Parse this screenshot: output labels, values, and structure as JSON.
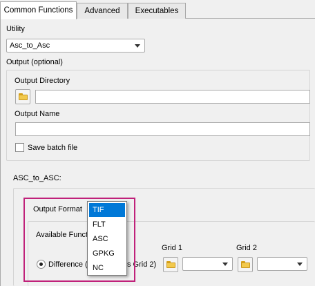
{
  "tabs": [
    "Common Functions",
    "Advanced",
    "Executables"
  ],
  "utility": {
    "label": "Utility",
    "value": "Asc_to_Asc"
  },
  "output": {
    "group_label": "Output (optional)",
    "directory_label": "Output Directory",
    "name_label": "Output Name",
    "batch_label": "Save batch file"
  },
  "asc_section": {
    "label": "ASC_to_ASC:",
    "format_label": "Output Format",
    "format_value": "TIF",
    "format_options": [
      "TIF",
      "FLT",
      "ASC",
      "GPKG",
      "NC"
    ],
    "available_label": "Available Functi",
    "radio_label": "Difference (",
    "radio_suffix": "s Grid 2)",
    "grid1_label": "Grid 1",
    "grid2_label": "Grid 2"
  },
  "colors": {
    "highlight": "#c0217a",
    "selection": "#0078d7"
  }
}
